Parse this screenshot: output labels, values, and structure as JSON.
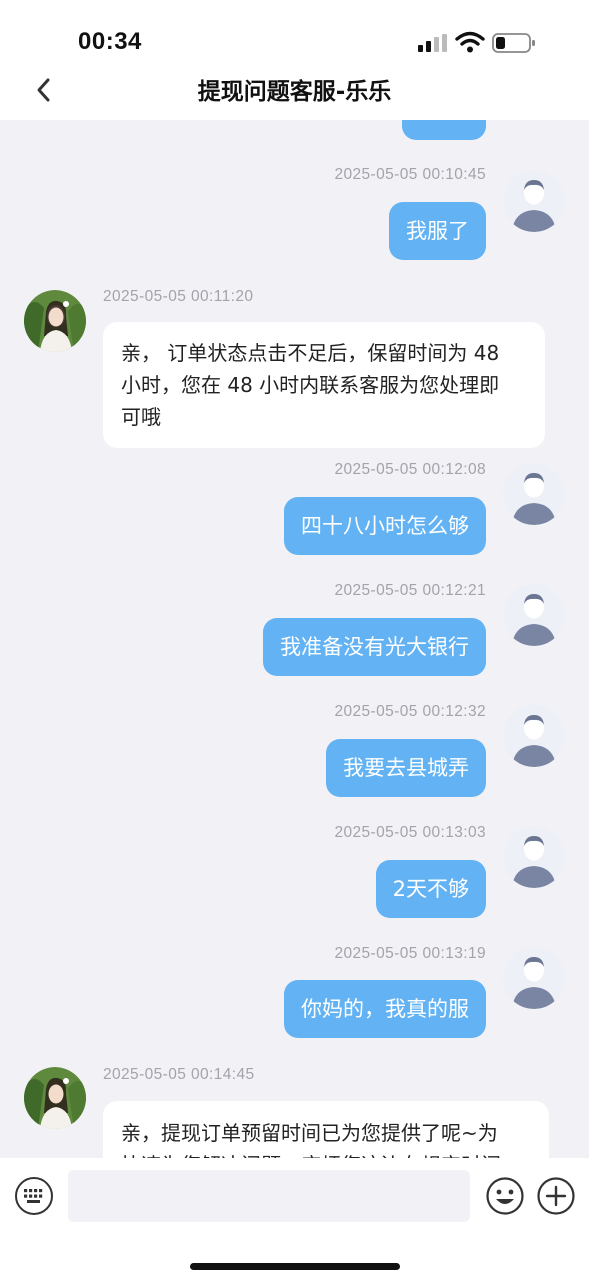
{
  "status_bar": {
    "time": "00:34",
    "icons": [
      "signal-icon",
      "wifi-icon",
      "battery-icon"
    ]
  },
  "nav": {
    "title": "提现问题客服-乐乐",
    "back_icon": "chevron-left-icon"
  },
  "messages": [
    {
      "side": "out",
      "time": "2025-05-05 00:10:45",
      "text": "我服了"
    },
    {
      "side": "in",
      "time": "2025-05-05 00:11:20",
      "lines": [
        "亲， 订单状态点击不足后，保留时间为 48",
        "小时，您在 48 小时内联系客服为您处理即",
        "可哦"
      ]
    },
    {
      "side": "out",
      "time": "2025-05-05 00:12:08",
      "text": "四十八小时怎么够"
    },
    {
      "side": "out",
      "time": "2025-05-05 00:12:21",
      "text": "我准备没有光大银行"
    },
    {
      "side": "out",
      "time": "2025-05-05 00:12:32",
      "text": "我要去县城弄"
    },
    {
      "side": "out",
      "time": "2025-05-05 00:13:03",
      "text": "2天不够"
    },
    {
      "side": "out",
      "time": "2025-05-05 00:13:19",
      "text": "你妈的，我真的服"
    },
    {
      "side": "in",
      "time": "2025-05-05 00:14:45",
      "lines": [
        "亲，提现订单预留时间已为您提供了呢~为",
        "快速为您解决问题，麻烦您这边在规定时间"
      ]
    }
  ],
  "input_bar": {
    "placeholder": "",
    "icons": [
      "keyboard-icon",
      "emoji-icon",
      "plus-icon"
    ]
  },
  "colors": {
    "outgoing_bubble": "#63b3f4",
    "incoming_bubble": "#ffffff",
    "background": "#f2f2f6",
    "timestamp": "#a2a3ab"
  }
}
